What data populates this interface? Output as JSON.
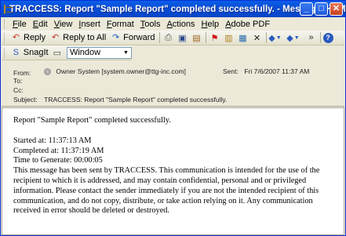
{
  "window": {
    "title": "TRACCESS: Report \"Sample Report\" completed successfully. - Message (HTML)",
    "minimize_glyph": "_",
    "maximize_glyph": "□",
    "close_glyph": "✕"
  },
  "menu": [
    "File",
    "Edit",
    "View",
    "Insert",
    "Format",
    "Tools",
    "Actions",
    "Help",
    "Adobe PDF"
  ],
  "toolbar": {
    "reply_label": "Reply",
    "reply_all_label": "Reply to All",
    "forward_label": "Forward"
  },
  "snagit": {
    "label": "SnagIt",
    "select_value": "Window"
  },
  "headers": {
    "from_label": "From:",
    "from_value": "Owner System [system.owner@ttg-inc.com]",
    "to_label": "To:",
    "cc_label": "Cc:",
    "subject_label": "Subject:",
    "subject_value": "TRACCESS: Report \"Sample Report\" completed successfully.",
    "sent_label": "Sent:",
    "sent_value": "Fri 7/6/2007 11:37 AM"
  },
  "message": {
    "line1": "Report \"Sample Report\" completed successfully.",
    "started": "Started at: 11:37:13 AM",
    "completed": "Completed at: 11:37:19 AM",
    "time_to_generate": "Time to Generate: 00:00:05",
    "disclaimer": "This message has been sent by TRACCESS. This communication is intended for the use of the recipient to which it is addressed, and may contain confidential, personal and or privileged information. Please contact the sender immediately if you are not the intended recipient of this communication, and do not copy, distribute, or take action relying on it. Any communication received in error should be deleted or destroyed."
  },
  "colors": {
    "titlebar": "#0a4fd6",
    "chrome": "#ece9d8",
    "close_button": "#c8411c"
  }
}
